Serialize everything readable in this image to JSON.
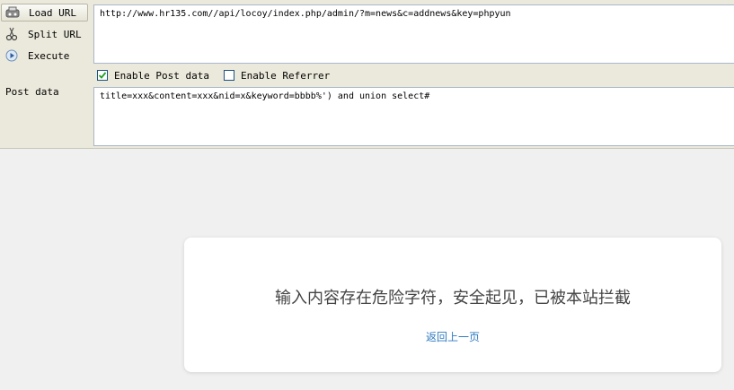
{
  "toolbar": {
    "load_url_label": "Load URL",
    "split_url_label": "Split URL",
    "execute_label": "Execute",
    "url_value": "http://www.hr135.com//api/locoy/index.php/admin/?m=news&c=addnews&key=phpyun",
    "enable_post_label": "Enable Post data",
    "enable_post_checked": true,
    "enable_referrer_label": "Enable Referrer",
    "enable_referrer_checked": false,
    "post_data_label": "Post data",
    "post_data_value": "title=xxx&content=xxx&nid=x&keyword=bbbb%') and union select#"
  },
  "block_card": {
    "message": "输入内容存在危险字符，安全起见，已被本站拦截",
    "back_link": "返回上一页",
    "link_color": "#2f7ac0"
  }
}
